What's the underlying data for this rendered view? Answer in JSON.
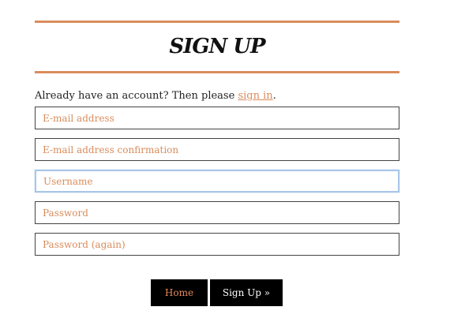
{
  "header": {
    "title": "SIGN UP"
  },
  "intro": {
    "text": "Already have an account? Then please ",
    "link_label": "sign in",
    "suffix": "."
  },
  "form": {
    "email_placeholder": "E-mail address",
    "email_confirm_placeholder": "E-mail address confirmation",
    "username_placeholder": "Username",
    "password_placeholder": "Password",
    "password_again_placeholder": "Password (again)"
  },
  "actions": {
    "home_label": "Home",
    "signup_label": "Sign Up »"
  },
  "colors": {
    "accent": "#d98c5c",
    "button_bg": "#000000",
    "focus_border": "#a9c6e8"
  }
}
